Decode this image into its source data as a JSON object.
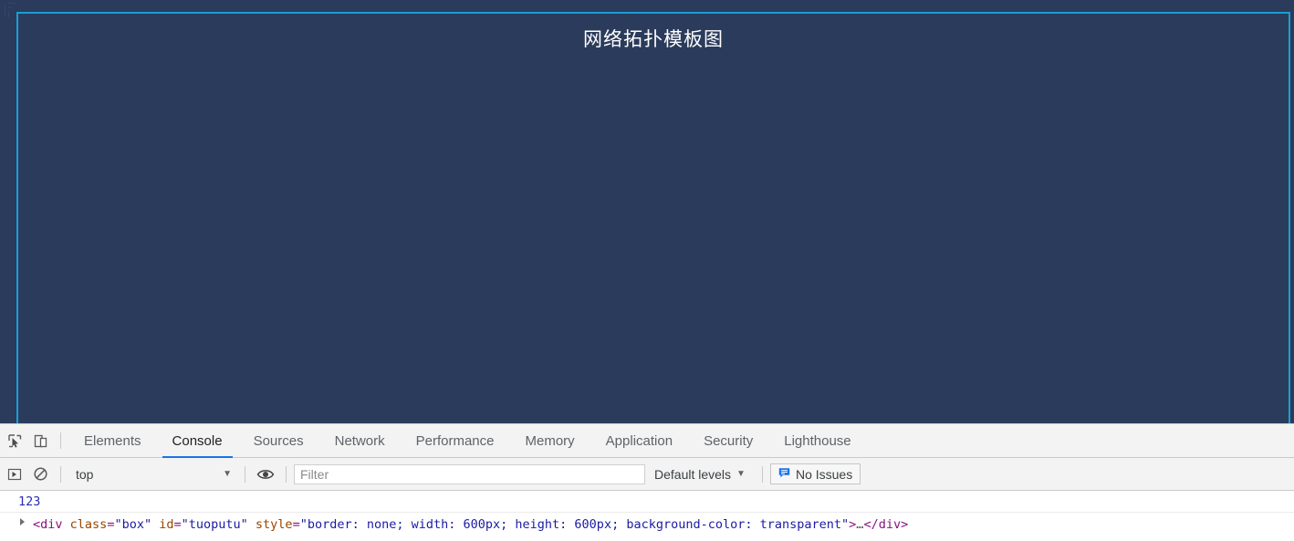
{
  "page": {
    "title": "网络拓扑模板图",
    "panel_bg": "#2b3b5c",
    "panel_border": "#189fd4"
  },
  "devtools": {
    "left_icons": [
      {
        "name": "inspect-element-icon",
        "label": "Inspect element"
      },
      {
        "name": "device-toolbar-icon",
        "label": "Toggle device toolbar"
      }
    ],
    "tabs": [
      {
        "label": "Elements",
        "active": false
      },
      {
        "label": "Console",
        "active": true
      },
      {
        "label": "Sources",
        "active": false
      },
      {
        "label": "Network",
        "active": false
      },
      {
        "label": "Performance",
        "active": false
      },
      {
        "label": "Memory",
        "active": false
      },
      {
        "label": "Application",
        "active": false
      },
      {
        "label": "Security",
        "active": false
      },
      {
        "label": "Lighthouse",
        "active": false
      }
    ],
    "active_tab_underline": "#1a73e8",
    "console_toolbar": {
      "execute_icon": "execute-console-icon",
      "clear_icon": "clear-console-icon",
      "context_value": "top",
      "context_caret": "▼",
      "eye_icon": "live-expression-eye-icon",
      "filter_placeholder": "Filter",
      "filter_value": "",
      "levels_label": "Default levels",
      "levels_caret": "▼",
      "issues_label": "No Issues",
      "issues_icon_color": "#1a73e8"
    },
    "console_messages": [
      {
        "type": "number",
        "text": "123"
      },
      {
        "type": "markup",
        "tokens": [
          {
            "t": "punc",
            "v": "<"
          },
          {
            "t": "tag",
            "v": "div"
          },
          {
            "t": "attr",
            "v": " class"
          },
          {
            "t": "punc",
            "v": "="
          },
          {
            "t": "val",
            "v": "\"box\""
          },
          {
            "t": "attr",
            "v": " id"
          },
          {
            "t": "punc",
            "v": "="
          },
          {
            "t": "val",
            "v": "\"tuoputu\""
          },
          {
            "t": "attr",
            "v": " style"
          },
          {
            "t": "punc",
            "v": "="
          },
          {
            "t": "val",
            "v": "\"border: none; width: 600px; height: 600px; background-color: transparent\""
          },
          {
            "t": "punc",
            "v": ">"
          },
          {
            "t": "ell",
            "v": "…"
          },
          {
            "t": "punc",
            "v": "</"
          },
          {
            "t": "tag",
            "v": "div"
          },
          {
            "t": "punc",
            "v": ">"
          }
        ]
      }
    ]
  }
}
